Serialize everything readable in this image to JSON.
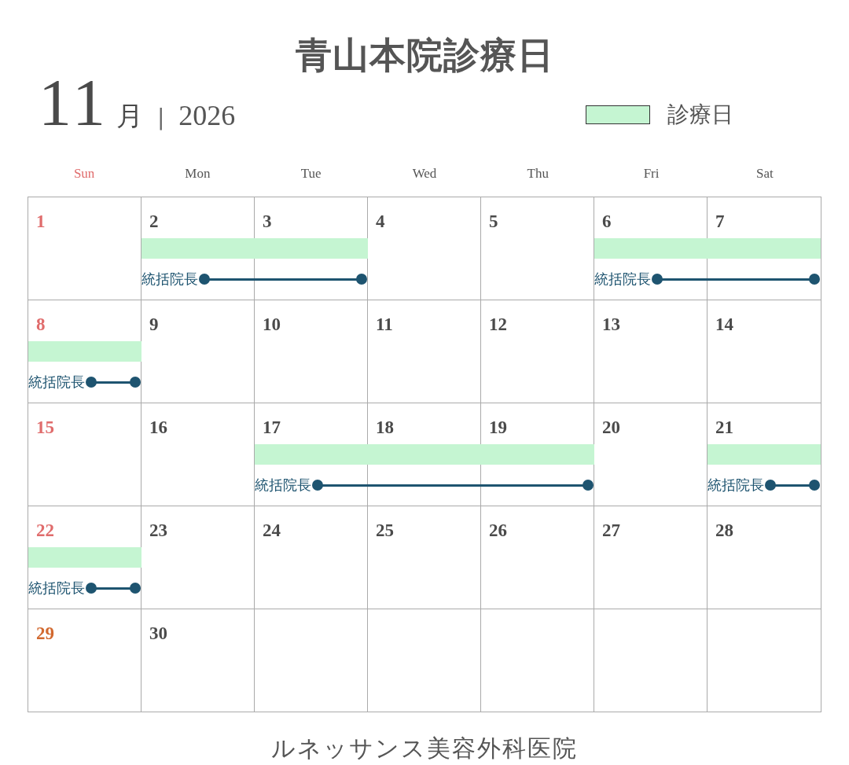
{
  "title": "青山本院診療日",
  "month": {
    "number": "11",
    "unit": "月",
    "separator": "|",
    "year": "2026"
  },
  "legend": {
    "label": "診療日",
    "color": "#c5f5d2"
  },
  "weekdays": [
    {
      "label": "Sun",
      "color": "#e06c6c"
    },
    {
      "label": "Mon",
      "color": "#555555"
    },
    {
      "label": "Tue",
      "color": "#555555"
    },
    {
      "label": "Wed",
      "color": "#555555"
    },
    {
      "label": "Thu",
      "color": "#555555"
    },
    {
      "label": "Fri",
      "color": "#555555"
    },
    {
      "label": "Sat",
      "color": "#555555"
    }
  ],
  "weeks": [
    {
      "days": [
        {
          "label": "1",
          "color": "#e06c6c",
          "clinic": false
        },
        {
          "label": "2",
          "color": "#4a4a4a",
          "clinic": true,
          "doctor": "統括院長"
        },
        {
          "label": "3",
          "color": "#4a4a4a",
          "clinic": true
        },
        {
          "label": "4",
          "color": "#4a4a4a",
          "clinic": false
        },
        {
          "label": "5",
          "color": "#4a4a4a",
          "clinic": false
        },
        {
          "label": "6",
          "color": "#4a4a4a",
          "clinic": true,
          "doctor": "統括院長"
        },
        {
          "label": "7",
          "color": "#4a4a4a",
          "clinic": true
        }
      ]
    },
    {
      "days": [
        {
          "label": "8",
          "color": "#e06c6c",
          "clinic": true,
          "doctor": "統括院長"
        },
        {
          "label": "9",
          "color": "#4a4a4a",
          "clinic": false
        },
        {
          "label": "10",
          "color": "#4a4a4a",
          "clinic": false
        },
        {
          "label": "11",
          "color": "#4a4a4a",
          "clinic": false
        },
        {
          "label": "12",
          "color": "#4a4a4a",
          "clinic": false
        },
        {
          "label": "13",
          "color": "#4a4a4a",
          "clinic": false
        },
        {
          "label": "14",
          "color": "#4a4a4a",
          "clinic": false
        }
      ]
    },
    {
      "days": [
        {
          "label": "15",
          "color": "#e06c6c",
          "clinic": false
        },
        {
          "label": "16",
          "color": "#4a4a4a",
          "clinic": false
        },
        {
          "label": "17",
          "color": "#4a4a4a",
          "clinic": true,
          "doctor": "統括院長"
        },
        {
          "label": "18",
          "color": "#4a4a4a",
          "clinic": true
        },
        {
          "label": "19",
          "color": "#4a4a4a",
          "clinic": true
        },
        {
          "label": "20",
          "color": "#4a4a4a",
          "clinic": false
        },
        {
          "label": "21",
          "color": "#4a4a4a",
          "clinic": true,
          "doctor": "統括院長"
        }
      ]
    },
    {
      "days": [
        {
          "label": "22",
          "color": "#e06c6c",
          "clinic": true,
          "doctor": "統括院長"
        },
        {
          "label": "23",
          "color": "#4a4a4a",
          "clinic": false
        },
        {
          "label": "24",
          "color": "#4a4a4a",
          "clinic": false
        },
        {
          "label": "25",
          "color": "#4a4a4a",
          "clinic": false
        },
        {
          "label": "26",
          "color": "#4a4a4a",
          "clinic": false
        },
        {
          "label": "27",
          "color": "#4a4a4a",
          "clinic": false
        },
        {
          "label": "28",
          "color": "#4a4a4a",
          "clinic": false
        }
      ]
    },
    {
      "days": [
        {
          "label": "29",
          "color": "#d2692f",
          "clinic": false
        },
        {
          "label": "30",
          "color": "#4a4a4a",
          "clinic": false
        }
      ]
    }
  ],
  "footer": "ルネッサンス美容外科医院"
}
